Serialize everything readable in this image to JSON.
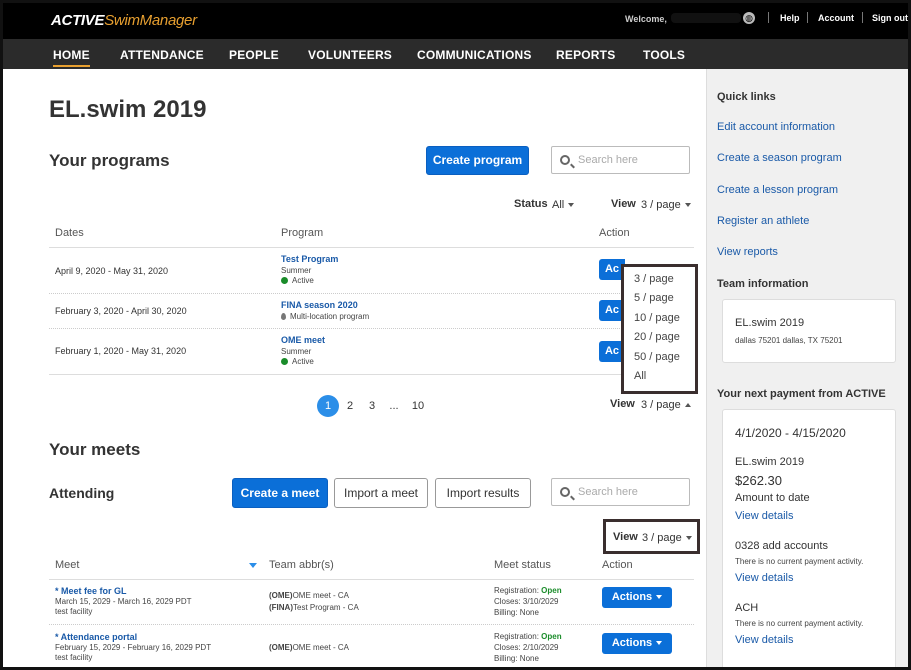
{
  "topbar": {
    "logo_bold": "ACTIVE",
    "logo_light": "SwimManager",
    "welcome": "Welcome,",
    "globe_icon": "globe-icon",
    "help": "Help",
    "account": "Account",
    "signout": "Sign out"
  },
  "nav": {
    "items": [
      "HOME",
      "ATTENDANCE",
      "PEOPLE",
      "VOLUNTEERS",
      "COMMUNICATIONS",
      "REPORTS",
      "TOOLS"
    ]
  },
  "main": {
    "title": "EL.swim 2019",
    "programs": {
      "heading": "Your programs",
      "create_button": "Create program",
      "search_placeholder": "Search here",
      "status_label": "Status",
      "status_value": "All",
      "view_label": "View",
      "view_value": "3 / page",
      "columns": [
        "Dates",
        "Program",
        "Action"
      ],
      "rows": [
        {
          "dates": "April 9, 2020 - May 31, 2020",
          "name": "Test Program",
          "sub": "Summer",
          "status": "Active"
        },
        {
          "dates": "February 3, 2020 - April 30, 2020",
          "name": "FINA season 2020",
          "sub": "Multi-location program"
        },
        {
          "dates": "February 1, 2020 - May 31, 2020",
          "name": "OME meet",
          "sub": "Summer",
          "status": "Active"
        }
      ],
      "action_partial": "Ac",
      "pagination": [
        "1",
        "2",
        "3",
        "...",
        "10"
      ],
      "view_bottom_label": "View",
      "view_bottom_value": "3 / page",
      "dropdown_options": [
        "3 / page",
        "5 / page",
        "10 / page",
        "20 / page",
        "50 / page",
        "All"
      ]
    },
    "meets": {
      "heading": "Your meets",
      "sub_heading": "Attending",
      "create_button": "Create a meet",
      "import_meet_button": "Import a meet",
      "import_results_button": "Import results",
      "search_placeholder": "Search here",
      "view_label": "View",
      "view_value": "3 / page",
      "columns": [
        "Meet",
        "Team abbr(s)",
        "Meet status",
        "Action"
      ],
      "rows": [
        {
          "name": "* Meet fee for GL",
          "dates": "March 15, 2029 - March 16, 2029 PDT",
          "facility": "test facility",
          "team1_abbr": "(OME)",
          "team1_rest": "OME meet - CA",
          "team2_abbr": "(FINA)",
          "team2_rest": "Test Program - CA",
          "reg_label": "Registration:",
          "reg_value": "Open",
          "closes": "Closes: 3/10/2029",
          "billing": "Billing: None",
          "action": "Actions"
        },
        {
          "name": "* Attendance portal",
          "dates": "February 15, 2029 - February 16, 2029 PDT",
          "facility": "test facility",
          "team1_abbr": "(OME)",
          "team1_rest": "OME meet - CA",
          "reg_label": "Registration:",
          "reg_value": "Open",
          "closes": "Closes: 2/10/2029",
          "billing": "Billing: None",
          "action": "Actions"
        }
      ]
    }
  },
  "sidebar": {
    "quick_links_heading": "Quick links",
    "links": [
      "Edit account information",
      "Create a season program",
      "Create a lesson program",
      "Register an athlete",
      "View reports"
    ],
    "team_heading": "Team information",
    "team_name": "EL.swim 2019",
    "team_address": "dallas 75201 dallas, TX 75201",
    "payment_heading": "Your next payment from ACTIVE",
    "payment_period": "4/1/2020 - 4/15/2020",
    "payment_team": "EL.swim 2019",
    "payment_amount": "$262.30",
    "payment_amount_label": "Amount to date",
    "view_details": "View details",
    "acct1_name": "0328 add accounts",
    "acct1_note": "There is no current payment activity.",
    "acct2_name": "ACH",
    "acct2_note": "There is no current payment activity."
  },
  "colors": {
    "brand_orange": "#e8a030",
    "primary_blue": "#0b6fd8",
    "link_blue": "#1a5aa8",
    "active_green": "#1a8c2a",
    "nav_bg": "#2b2b2b"
  }
}
